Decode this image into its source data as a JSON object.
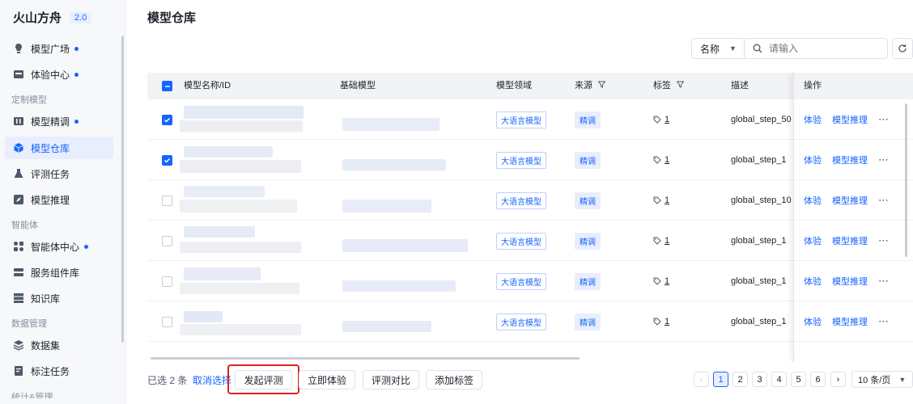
{
  "app": {
    "name": "火山方舟",
    "version": "2.0"
  },
  "sidebar": {
    "groups": {
      "custom": "定制模型",
      "agent": "智能体",
      "data": "数据管理",
      "partial": "统计&管理"
    },
    "items": [
      {
        "label": "模型广场",
        "dot": true,
        "icon": "bulb-icon"
      },
      {
        "label": "体验中心",
        "dot": true,
        "icon": "inbox-icon"
      },
      {
        "label": "模型精调",
        "dot": true,
        "icon": "tune-icon"
      },
      {
        "label": "模型仓库",
        "dot": false,
        "icon": "cube-icon"
      },
      {
        "label": "评测任务",
        "dot": false,
        "icon": "flask-icon"
      },
      {
        "label": "模型推理",
        "dot": false,
        "icon": "rocket-icon"
      },
      {
        "label": "智能体中心",
        "dot": true,
        "icon": "apps-icon"
      },
      {
        "label": "服务组件库",
        "dot": false,
        "icon": "server-icon"
      },
      {
        "label": "知识库",
        "dot": false,
        "icon": "database-icon"
      },
      {
        "label": "数据集",
        "dot": false,
        "icon": "layers-icon"
      },
      {
        "label": "标注任务",
        "dot": false,
        "icon": "doc-edit-icon"
      }
    ]
  },
  "page": {
    "title": "模型仓库"
  },
  "filter": {
    "field": "名称",
    "placeholder": "请输入"
  },
  "table": {
    "headers": {
      "name": "模型名称/ID",
      "base": "基础模型",
      "domain": "模型领域",
      "source": "来源",
      "labels": "标签",
      "desc": "描述",
      "ops": "操作"
    },
    "rows": [
      {
        "checked": true,
        "domain": "大语言模型",
        "source": "精调",
        "label_count": "1",
        "desc": "global_step_50"
      },
      {
        "checked": true,
        "domain": "大语言模型",
        "source": "精调",
        "label_count": "1",
        "desc": "global_step_1"
      },
      {
        "checked": false,
        "domain": "大语言模型",
        "source": "精调",
        "label_count": "1",
        "desc": "global_step_10"
      },
      {
        "checked": false,
        "domain": "大语言模型",
        "source": "精调",
        "label_count": "1",
        "desc": "global_step_1"
      },
      {
        "checked": false,
        "domain": "大语言模型",
        "source": "精调",
        "label_count": "1",
        "desc": "global_step_1"
      },
      {
        "checked": false,
        "domain": "大语言模型",
        "source": "精调",
        "label_count": "1",
        "desc": "global_step_1"
      }
    ],
    "actions": {
      "try": "体验",
      "infer": "模型推理"
    }
  },
  "footer": {
    "selected": "已选 2 条",
    "cancel": "取消选择",
    "buttons": {
      "evaluate": "发起评测",
      "try_now": "立即体验",
      "compare": "评测对比",
      "add_tag": "添加标签"
    }
  },
  "pagination": {
    "pages": [
      "1",
      "2",
      "3",
      "4",
      "5",
      "6"
    ],
    "current": "1",
    "page_size": "10 条/页"
  },
  "colors": {
    "accent": "#1664ff",
    "highlight": "#e02020"
  }
}
